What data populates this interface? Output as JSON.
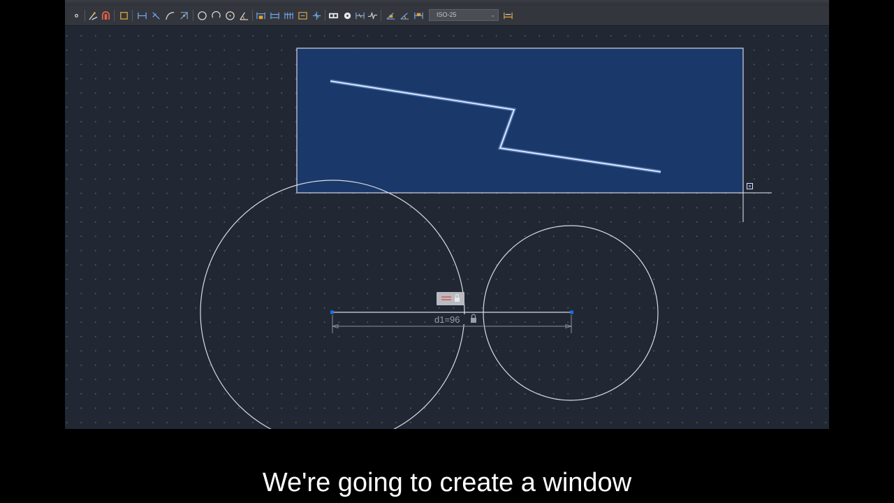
{
  "toolbar": {
    "tools": [
      {
        "icon": "point-icon"
      },
      {
        "icon": "linear-dimension-icon"
      },
      {
        "icon": "magnet-snap-icon"
      },
      {
        "icon": "rectangle-select-icon"
      },
      {
        "icon": "horizontal-constraint-icon"
      },
      {
        "icon": "perpendicular-constraint-icon"
      },
      {
        "icon": "tangent-constraint-icon"
      },
      {
        "icon": "coincident-constraint-icon"
      },
      {
        "icon": "circle-icon"
      },
      {
        "icon": "arc-icon"
      },
      {
        "icon": "ellipse-icon"
      },
      {
        "icon": "angle-icon"
      },
      {
        "icon": "dimension-linear-icon"
      },
      {
        "icon": "dimension-aligned-icon"
      },
      {
        "icon": "dimension-baseline-icon"
      },
      {
        "icon": "dimension-continue-icon"
      },
      {
        "icon": "dimension-ordinate-icon"
      },
      {
        "icon": "tolerance-icon"
      },
      {
        "icon": "center-mark-icon"
      },
      {
        "icon": "dimension-break-icon"
      },
      {
        "icon": "dimension-jog-icon"
      },
      {
        "icon": "dimension-angular-icon"
      },
      {
        "icon": "dimension-update-icon"
      },
      {
        "icon": "dimension-style-icon"
      }
    ],
    "dimension_style": "ISO-25"
  },
  "drawing": {
    "dimension_label": "d1=96",
    "lock_icon": "lock-icon",
    "colors": {
      "selection_fill": "#1a3a6e",
      "selection_border": "#d0d6e4",
      "geometry": "#d8dce4",
      "grip": "#1e6fe0"
    }
  },
  "subtitle": "We're going to create a window"
}
